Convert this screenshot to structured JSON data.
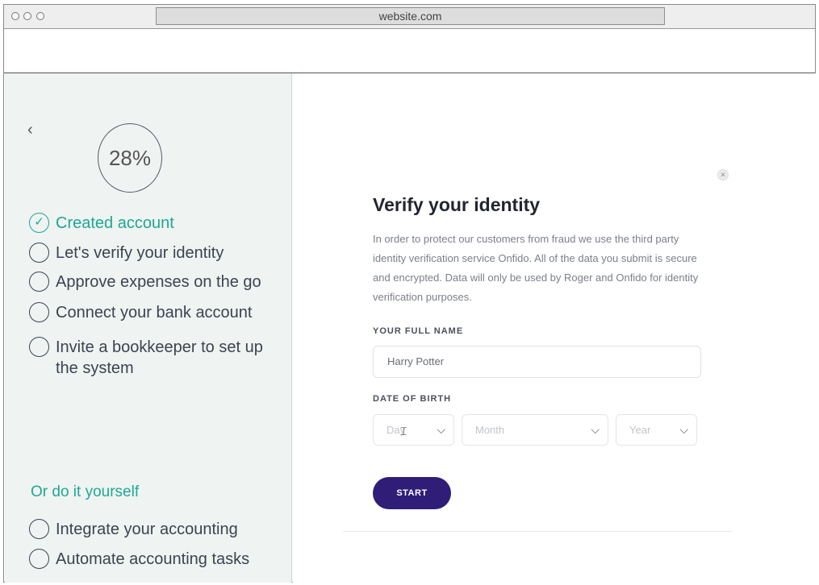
{
  "browser": {
    "url": "website.com"
  },
  "sidebar": {
    "progress": "28%",
    "steps": [
      {
        "label": "Created account",
        "done": true
      },
      {
        "label": "Let's verify your identity",
        "done": false
      },
      {
        "label": "Approve expenses on the go",
        "done": false
      },
      {
        "label": "Connect your bank account",
        "done": false
      },
      {
        "label": "Invite a bookkeeper to set up the system",
        "done": false
      }
    ],
    "section_title": "Or do it yourself",
    "diy_steps": [
      {
        "label": "Integrate your accounting"
      },
      {
        "label": "Automate accounting tasks"
      }
    ]
  },
  "verify": {
    "title": "Verify your identity",
    "description": "In order to protect our customers from fraud we use the third party identity verification service Onfido. All of the data you submit is secure and encrypted. Data will only be used by Roger and Onfido for identity verification purposes.",
    "name_label": "YOUR FULL NAME",
    "name_value": "Harry Potter",
    "dob_label": "DATE OF BIRTH",
    "day_placeholder": "Day",
    "month_placeholder": "Month",
    "year_placeholder": "Year",
    "start_label": "START"
  },
  "icons": {
    "back": "chevron-left-icon",
    "close": "close-icon",
    "check": "check-icon",
    "chevron": "chevron-down-icon",
    "cursor": "text-cursor-icon"
  },
  "colors": {
    "accent_green": "#1ea891",
    "button_purple": "#2f1d78",
    "sidebar_bg": "#eff3f2"
  }
}
